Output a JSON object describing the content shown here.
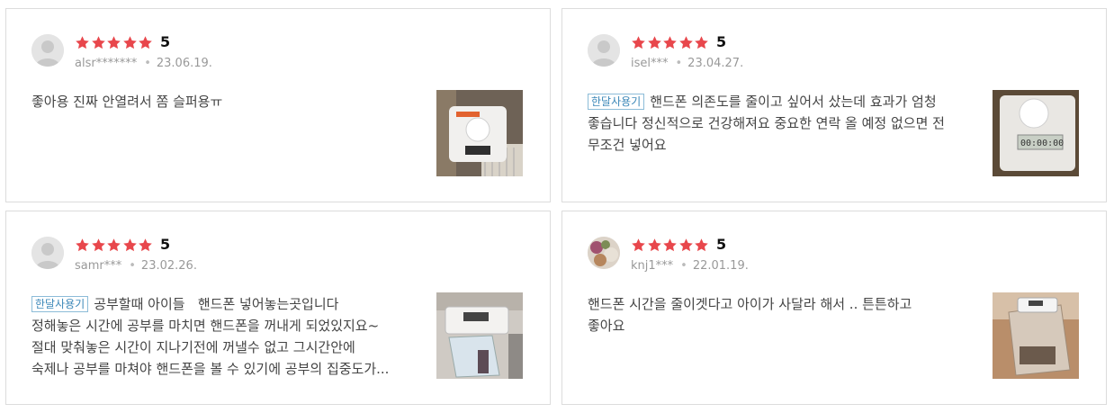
{
  "star_color": "#e8474c",
  "reviews": [
    {
      "rating": "5",
      "user": "alsr*******",
      "date": "23.06.19.",
      "badge": "",
      "lines": [
        "좋아용 진짜 안열려서 쫌 슬퍼용ㅠ"
      ],
      "thumb_icon": "product-photo"
    },
    {
      "rating": "5",
      "user": "isel***",
      "date": "23.04.27.",
      "badge": "한달사용기",
      "lines": [
        "핸드폰 의존도를 줄이고 싶어서 샀는데 효과가 엄청",
        "좋습니다 정신적으로 건강해져요 중요한 연락 올 예정 없으면 전",
        "무조건 넣어요"
      ],
      "thumb_icon": "product-photo"
    },
    {
      "rating": "5",
      "user": "samr***",
      "date": "23.02.26.",
      "badge": "한달사용기",
      "lines": [
        "공부할때 아이들   핸드폰 넣어놓는곳입니다",
        "정해놓은 시간에 공부를 마치면 핸드폰을 꺼내게 되었있지요~",
        "절대 맞춰놓은 시간이 지나기전에 꺼낼수 없고 그시간안에",
        "숙제나 공부를 마쳐야 핸드폰을 볼 수 있기에 공부의 집중도가..."
      ],
      "thumb_icon": "product-photo"
    },
    {
      "rating": "5",
      "user": "knj1***",
      "date": "22.01.19.",
      "badge": "",
      "lines": [
        "핸드폰 시간을 줄이겟다고 아이가 사달라 해서 .. 튼튼하고",
        "좋아요"
      ],
      "thumb_icon": "product-photo"
    }
  ]
}
